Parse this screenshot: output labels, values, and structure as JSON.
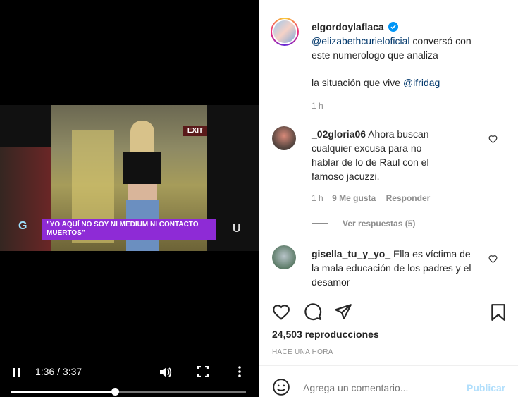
{
  "video": {
    "banner_text": "\"YO AQUÍ NO SOY NI MEDIUM NI CONTACTO MUERTOS\"",
    "exit_sign": "EXIT",
    "time": "1:36 / 3:37",
    "progress": 0.4424
  },
  "post": {
    "username": "elgordoylaflaca",
    "caption_mention": "@elizabethcurieloficial",
    "caption_line1_rest": " conversó con",
    "caption_line2": "este numerologo que analiza",
    "caption_line3": "la situación que vive ",
    "caption_mention2": "@ifridag",
    "time_ago": "1 h"
  },
  "comments": [
    {
      "username": "_02gloria06",
      "text_line1": " Ahora buscan",
      "text_rest": "cualquier excusa para no hablar de lo de Raul con el famoso jacuzzi.",
      "time": "1 h",
      "likes": "9 Me gusta",
      "reply": "Responder",
      "view_replies": "Ver respuestas (5)"
    },
    {
      "username": "gisella_tu_y_yo_",
      "text_line1": " Ella es víctima de",
      "text_rest": "la mala educación de los padres y el desamor"
    }
  ],
  "actions": {
    "views": "24,503 reproducciones",
    "posted": "HACE UNA HORA",
    "comment_placeholder": "Agrega un comentario...",
    "publish": "Publicar"
  },
  "colors": {
    "link": "#00376b",
    "publish": "#b2dffc",
    "verified": "#0095f6",
    "banner": "#8e2bd6"
  }
}
